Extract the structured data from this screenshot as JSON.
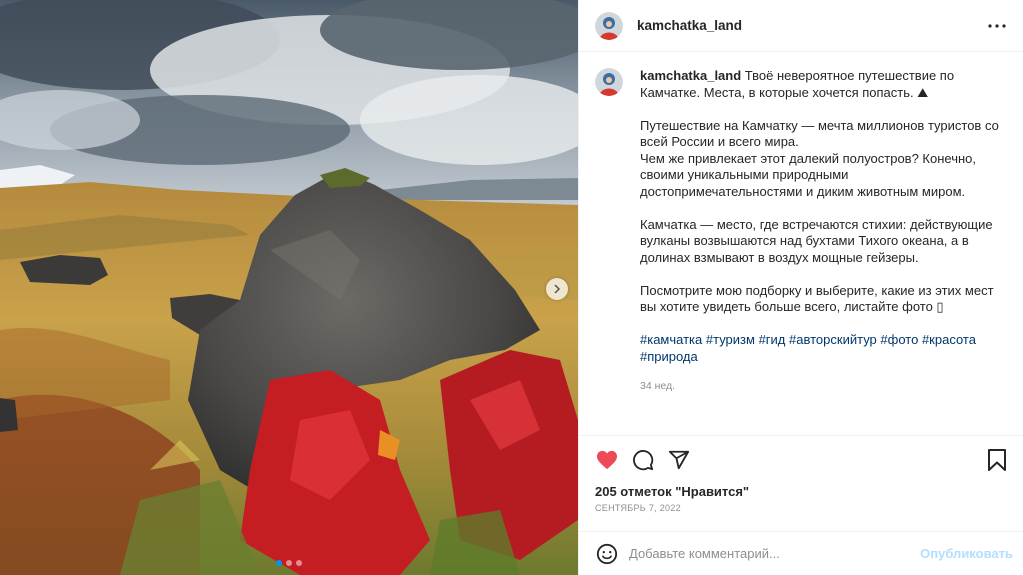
{
  "post": {
    "username": "kamchatka_land",
    "more_icon": "more-horizontal-icon",
    "caption": {
      "username": "kamchatka_land",
      "paragraph1": "Твоё невероятное путешествие по Камчатке. Места, в которые хочется попасть. ⛰",
      "paragraph2_line1": "Путешествие на Камчатку — мечта миллионов туристов со всей России и всего мира.",
      "paragraph2_line2": "Чем же привлекает этот далекий полуостров? Конечно, своими уникальными природными достопримечательностями и диким животным миром.",
      "paragraph3": "Камчатка — место, где встречаются стихии: действующие вулканы возвышаются над бухтами Тихого океана, а в долинах взмывают в воздух мощные гейзеры.",
      "paragraph4": "Посмотрите мою подборку и выберите, какие из этих мест вы хотите увидеть больше всего, листайте фото ▯",
      "hashtags": [
        "#камчатка",
        "#туризм",
        "#гид",
        "#авторскийтур",
        "#фото",
        "#красота",
        "#природа"
      ],
      "age": "34 нед."
    },
    "likes": "205 отметок \"Нравится\"",
    "date": "СЕНТЯБРЬ 7, 2022",
    "liked": true,
    "comment": {
      "placeholder": "Добавьте комментарий...",
      "publish_label": "Опубликовать"
    },
    "carousel": {
      "slide_count": 3,
      "active_index": 0
    }
  },
  "icons": {
    "like": "heart-filled-icon",
    "comment": "comment-icon",
    "share": "share-icon",
    "save": "bookmark-icon",
    "emoji": "emoji-icon",
    "next": "chevron-right-icon"
  },
  "colors": {
    "like_red": "#ed4956",
    "link_blue": "#00376b",
    "publish_disabled": "#b2dffc",
    "muted": "#8e8e8e"
  }
}
